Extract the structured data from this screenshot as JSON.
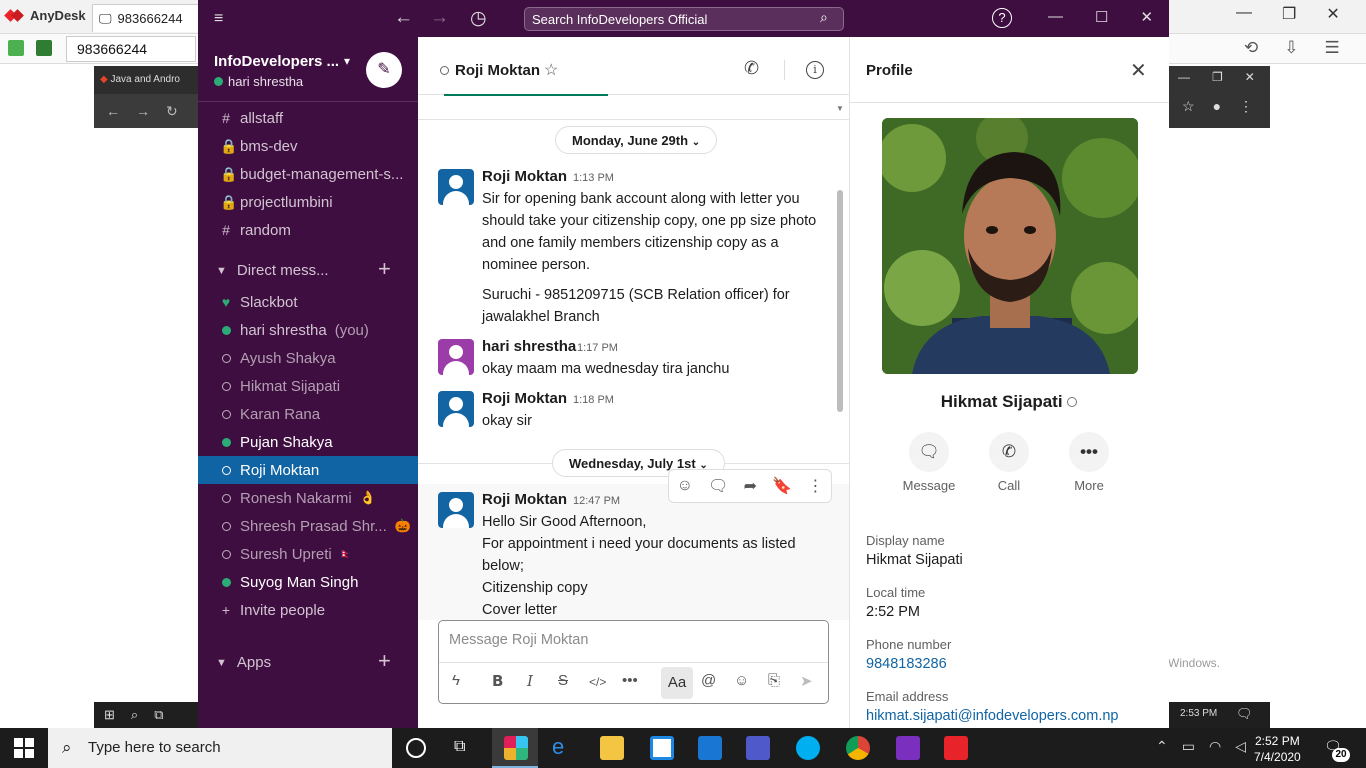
{
  "anydesk": {
    "app_name": "AnyDesk",
    "tab_label": "983666244",
    "remote_id": "983666244"
  },
  "browser": {
    "tab_title": "Java and Andro",
    "watermark": "Windows."
  },
  "remote_taskbar": {
    "time": "2:53 PM"
  },
  "slack": {
    "search_placeholder": "Search InfoDevelopers Official",
    "workspace": "InfoDevelopers ...",
    "current_user": "hari shrestha",
    "channels": [
      {
        "prefix": "#",
        "name": "allstaff"
      },
      {
        "prefix": "🔒",
        "name": "bms-dev"
      },
      {
        "prefix": "🔒",
        "name": "budget-management-s..."
      },
      {
        "prefix": "🔒",
        "name": "projectlumbini"
      },
      {
        "prefix": "#",
        "name": "random"
      }
    ],
    "dm_section": "Direct mess...",
    "dms": [
      {
        "name": "Slackbot",
        "status": "heart",
        "suffix": ""
      },
      {
        "name": "hari shrestha",
        "status": "online",
        "suffix": "(you)"
      },
      {
        "name": "Ayush Shakya",
        "status": "away",
        "suffix": ""
      },
      {
        "name": "Hikmat Sijapati",
        "status": "away",
        "suffix": ""
      },
      {
        "name": "Karan Rana",
        "status": "away",
        "suffix": ""
      },
      {
        "name": "Pujan Shakya",
        "status": "online",
        "suffix": ""
      },
      {
        "name": "Roji Moktan",
        "status": "away",
        "suffix": ""
      },
      {
        "name": "Ronesh Nakarmi",
        "status": "away",
        "suffix": "👌"
      },
      {
        "name": "Shreesh Prasad Shr...",
        "status": "away",
        "suffix": "🎃"
      },
      {
        "name": "Suresh Upreti",
        "status": "away",
        "suffix": "🇳🇵"
      },
      {
        "name": "Suyog Man Singh",
        "status": "online",
        "suffix": ""
      }
    ],
    "invite_label": "Invite people",
    "apps_section": "Apps",
    "channel": {
      "name": "Roji Moktan",
      "composer_placeholder": "Message Roji Moktan"
    },
    "dates": [
      "Monday, June 29th",
      "Wednesday, July 1st"
    ],
    "messages": [
      {
        "author": "Roji Moktan",
        "time": "1:13 PM",
        "paragraphs": [
          "Sir for opening bank account along with letter you should take your citizenship copy, one pp size photo and one family members citizenship copy as a nominee person.",
          "Suruchi - 9851209715 (SCB Relation officer) for jawalakhel Branch"
        ]
      },
      {
        "author": "hari shrestha",
        "time": "1:17 PM",
        "paragraphs": [
          "okay maam ma wednesday tira janchu"
        ]
      },
      {
        "author": "Roji Moktan",
        "time": "1:18 PM",
        "paragraphs": [
          "okay sir"
        ]
      },
      {
        "author": "Roji Moktan",
        "time": "12:47 PM",
        "lines": [
          "Hello Sir Good Afternoon,",
          "For appointment i need your documents as listed below;",
          "Citizenship copy",
          "Cover letter"
        ]
      }
    ]
  },
  "profile": {
    "title": "Profile",
    "name": "Hikmat Sijapati",
    "actions": [
      "Message",
      "Call",
      "More"
    ],
    "fields": [
      {
        "label": "Display name",
        "value": "Hikmat Sijapati"
      },
      {
        "label": "Local time",
        "value": "2:52 PM"
      },
      {
        "label": "Phone number",
        "value": "9848183286"
      },
      {
        "label": "Email address",
        "value": "hikmat.sijapati@infodevelopers.com.np"
      }
    ]
  },
  "taskbar": {
    "search_placeholder": "Type here to search",
    "time": "2:52 PM",
    "date": "7/4/2020",
    "notifications": "20"
  },
  "colors": {
    "slack_aubergine": "#3f0e40",
    "active_item": "#1164a3",
    "presence_green": "#2bac76",
    "link_blue": "#1264a3"
  }
}
